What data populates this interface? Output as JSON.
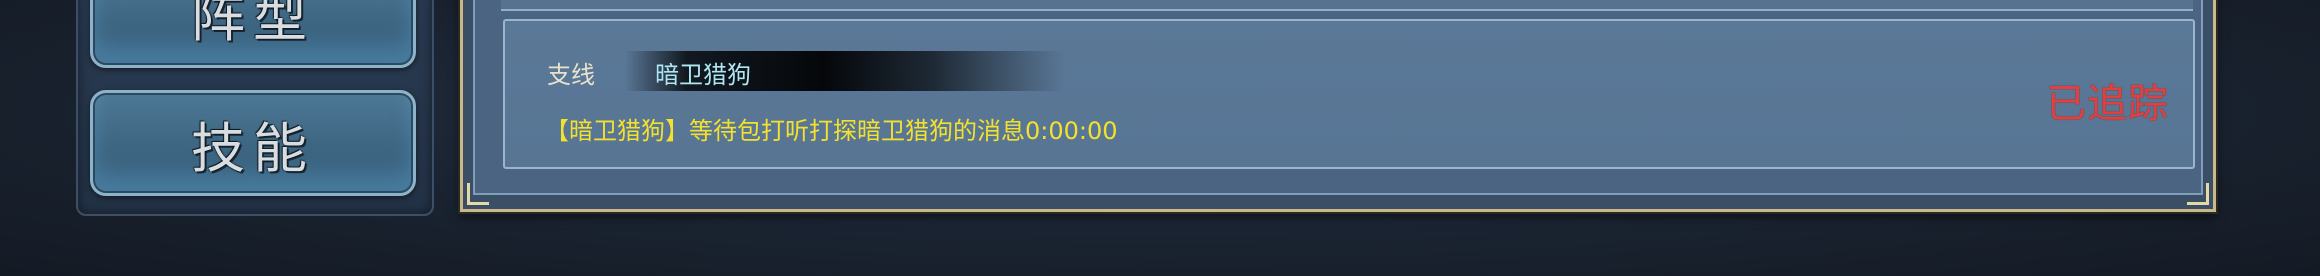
{
  "side_menu": {
    "formation_label": "阵型",
    "skills_label": "技能"
  },
  "quest": {
    "type_label": "支线",
    "name": "暗卫猎狗",
    "description": "【暗卫猎狗】等待包打听打探暗卫猎狗的消息0:00:00",
    "status": "已追踪"
  },
  "colors": {
    "quest_description": "#f4e12e",
    "quest_name": "#aee6f2",
    "tracked_status": "#e0413f",
    "frame_border": "#c9b98a"
  }
}
